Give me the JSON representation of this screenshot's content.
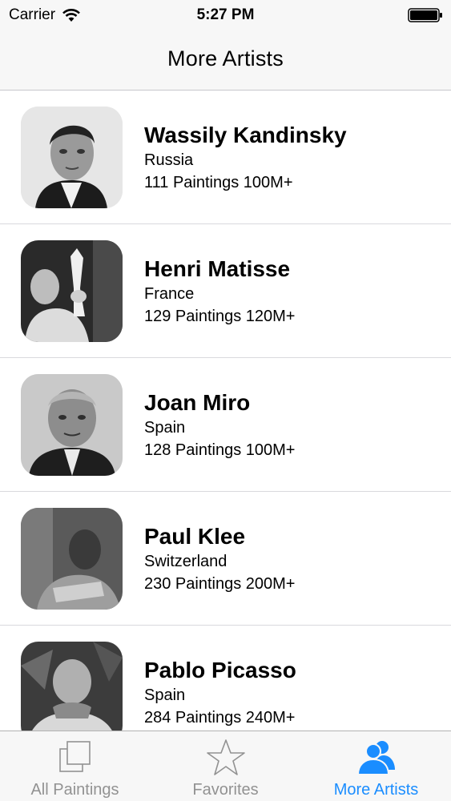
{
  "status_bar": {
    "carrier": "Carrier",
    "time": "5:27 PM",
    "wifi_icon": "wifi-icon",
    "battery_icon": "battery-icon"
  },
  "nav": {
    "title": "More Artists"
  },
  "artists": [
    {
      "name": "Wassily Kandinsky",
      "country": "Russia",
      "stats": "111 Paintings 100M+",
      "photo": "portrait-photo"
    },
    {
      "name": "Henri Matisse",
      "country": "France",
      "stats": "129 Paintings 120M+",
      "photo": "portrait-photo"
    },
    {
      "name": "Joan Miro",
      "country": "Spain",
      "stats": "128 Paintings 100M+",
      "photo": "portrait-photo"
    },
    {
      "name": "Paul Klee",
      "country": "Switzerland",
      "stats": "230 Paintings 200M+",
      "photo": "portrait-photo"
    },
    {
      "name": "Pablo Picasso",
      "country": "Spain",
      "stats": "284 Paintings 240M+",
      "photo": "portrait-photo"
    }
  ],
  "tab_bar": {
    "tabs": [
      {
        "label": "All Paintings",
        "icon": "stacked-squares-icon",
        "active": false
      },
      {
        "label": "Favorites",
        "icon": "star-icon",
        "active": false
      },
      {
        "label": "More Artists",
        "icon": "people-icon",
        "active": true
      }
    ]
  },
  "colors": {
    "accent": "#1a8dff",
    "inactive_tab": "#929292",
    "bar_background": "#f7f7f7"
  }
}
